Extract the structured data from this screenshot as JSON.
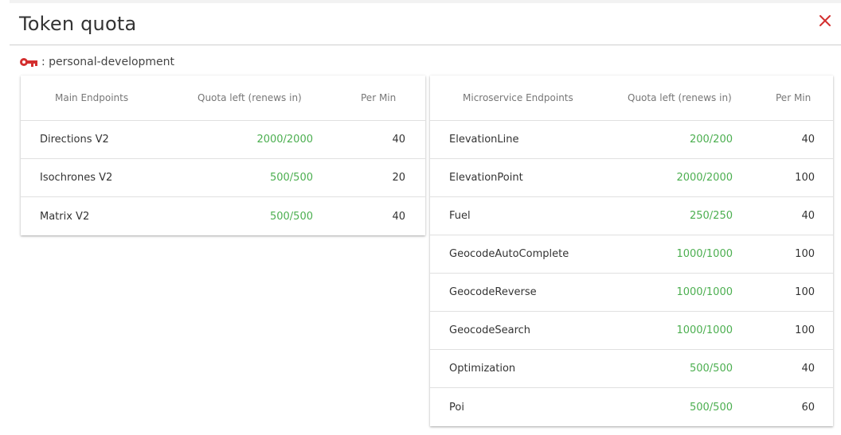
{
  "dialog": {
    "title": "Token quota",
    "close_icon": "close-icon",
    "accent_color": "#d32f2f"
  },
  "token": {
    "icon": "key-icon",
    "label": ": personal-development"
  },
  "main_table": {
    "columns": [
      "Main Endpoints",
      "Quota left (renews in)",
      "Per Min"
    ],
    "rows": [
      {
        "name": "Directions V2",
        "quota": "2000/2000",
        "per_min": "40"
      },
      {
        "name": "Isochrones V2",
        "quota": "500/500",
        "per_min": "20"
      },
      {
        "name": "Matrix V2",
        "quota": "500/500",
        "per_min": "40"
      }
    ]
  },
  "micro_table": {
    "columns": [
      "Microservice Endpoints",
      "Quota left (renews in)",
      "Per Min"
    ],
    "rows": [
      {
        "name": "ElevationLine",
        "quota": "200/200",
        "per_min": "40"
      },
      {
        "name": "ElevationPoint",
        "quota": "2000/2000",
        "per_min": "100"
      },
      {
        "name": "Fuel",
        "quota": "250/250",
        "per_min": "40"
      },
      {
        "name": "GeocodeAutoComplete",
        "quota": "1000/1000",
        "per_min": "100"
      },
      {
        "name": "GeocodeReverse",
        "quota": "1000/1000",
        "per_min": "100"
      },
      {
        "name": "GeocodeSearch",
        "quota": "1000/1000",
        "per_min": "100"
      },
      {
        "name": "Optimization",
        "quota": "500/500",
        "per_min": "40"
      },
      {
        "name": "Poi",
        "quota": "500/500",
        "per_min": "60"
      }
    ]
  },
  "colors": {
    "quota_green": "#4caf50",
    "header_text": "#777777"
  }
}
